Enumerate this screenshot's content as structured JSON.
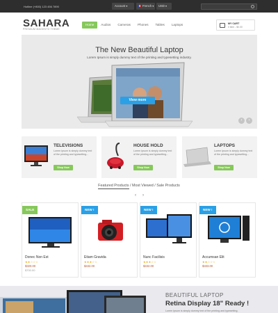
{
  "topbar": {
    "hotline": "Hotline (+800) 123 456 7890",
    "account": "Account",
    "language": "French",
    "currency": "USD"
  },
  "header": {
    "logo": "SAHARA",
    "tagline": "PREMIUM MAGENTO THEME",
    "nav": [
      "Home",
      "Audios",
      "Cameras",
      "Phones",
      "Tables",
      "Laptops"
    ],
    "cart_title": "MY CART",
    "cart_summary": "0 item - $0.00"
  },
  "hero": {
    "title": "The New Beautiful Laptop",
    "subtitle": "Lorem Ipsum is simply dummy text of the printing and typesetting industry.",
    "button": "View more"
  },
  "categories": [
    {
      "title": "TELEVISIONS",
      "desc": "Lorem Ipsum is simply dummy text of the printing and typesetting...",
      "button": "Shop Now"
    },
    {
      "title": "HOUSE HOLD",
      "desc": "Lorem Ipsum is simply dummy text of the printing and typesetting...",
      "button": "Shop Now"
    },
    {
      "title": "LAPTOPS",
      "desc": "Lorem Ipsum is simply dummy text of the printing and typesetting...",
      "button": "Shop Now"
    }
  ],
  "tabs": {
    "featured": "Featured Products",
    "sep1": " / ",
    "most_viewed": "Most Viewed",
    "sep2": " / ",
    "sale": "Sale Products"
  },
  "products": [
    {
      "badge": "SALE",
      "name": "Donec Non Est",
      "rating": "★★☆☆☆",
      "price": "$320.00",
      "old_price": "$700.00"
    },
    {
      "badge": "NEW !",
      "name": "Etiam Gravida",
      "rating": "★★★☆☆",
      "price": "$432.00",
      "old_price": ""
    },
    {
      "badge": "NEW !",
      "name": "Nunc Facilisis",
      "rating": "★★★☆☆",
      "price": "$432.00",
      "old_price": ""
    },
    {
      "badge": "NEW !",
      "name": "Accumsan Elit",
      "rating": "★★☆☆☆",
      "price": "$333.00",
      "old_price": ""
    }
  ],
  "banner": {
    "title": "BEAUTIFUL LAPTOP",
    "subtitle": "Retina Display 18\" Ready !",
    "desc": "Lorem Ipsum is simply dummy text of the printing and typesetting."
  },
  "colors": {
    "accent_green": "#86c85a",
    "accent_blue": "#2aa0e6",
    "topbar_dark": "#2e2e2e"
  }
}
